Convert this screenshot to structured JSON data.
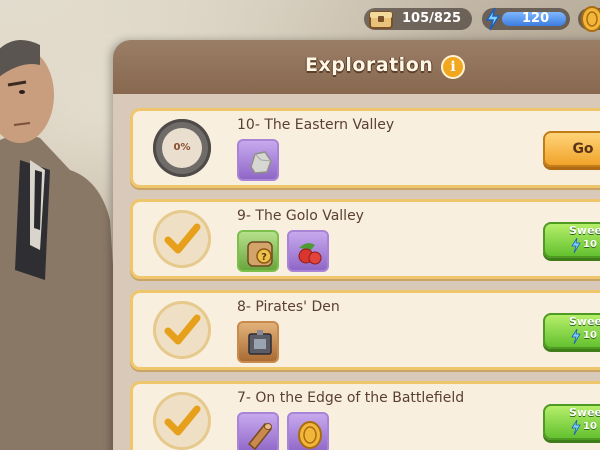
{
  "resources": {
    "chests": {
      "value": "105/825",
      "icon": "chest-icon"
    },
    "energy": {
      "value": "120",
      "icon": "lightning-bolt-icon",
      "color": "#3d7de0"
    },
    "coins": {
      "icon": "gold-coin-icon"
    }
  },
  "panel": {
    "title": "Exploration",
    "info_icon": "i"
  },
  "locations": [
    {
      "title": "10- The Eastern Valley",
      "progress": "0%",
      "completed": false,
      "rewards": [
        "stone-icon"
      ],
      "action": {
        "type": "go",
        "label": "Go"
      }
    },
    {
      "title": "9- The Golo Valley",
      "completed": true,
      "rewards": [
        "mystery-barrel-icon",
        "berries-icon"
      ],
      "action": {
        "type": "sweep",
        "label": "Sweep",
        "cost": "10"
      }
    },
    {
      "title": "8- Pirates' Den",
      "completed": true,
      "rewards": [
        "machine-part-icon"
      ],
      "action": {
        "type": "sweep",
        "label": "Sweep",
        "cost": "10"
      }
    },
    {
      "title": "7- On the Edge of the Battlefield",
      "completed": true,
      "rewards": [
        "wood-log-icon",
        "gold-coin-icon"
      ],
      "action": {
        "type": "sweep",
        "label": "Sweep",
        "cost": "10"
      }
    }
  ],
  "colors": {
    "go_button": "#f0a32a",
    "sweep_button": "#64c130",
    "card_border": "#efc66b",
    "panel_header": "#87684f"
  }
}
